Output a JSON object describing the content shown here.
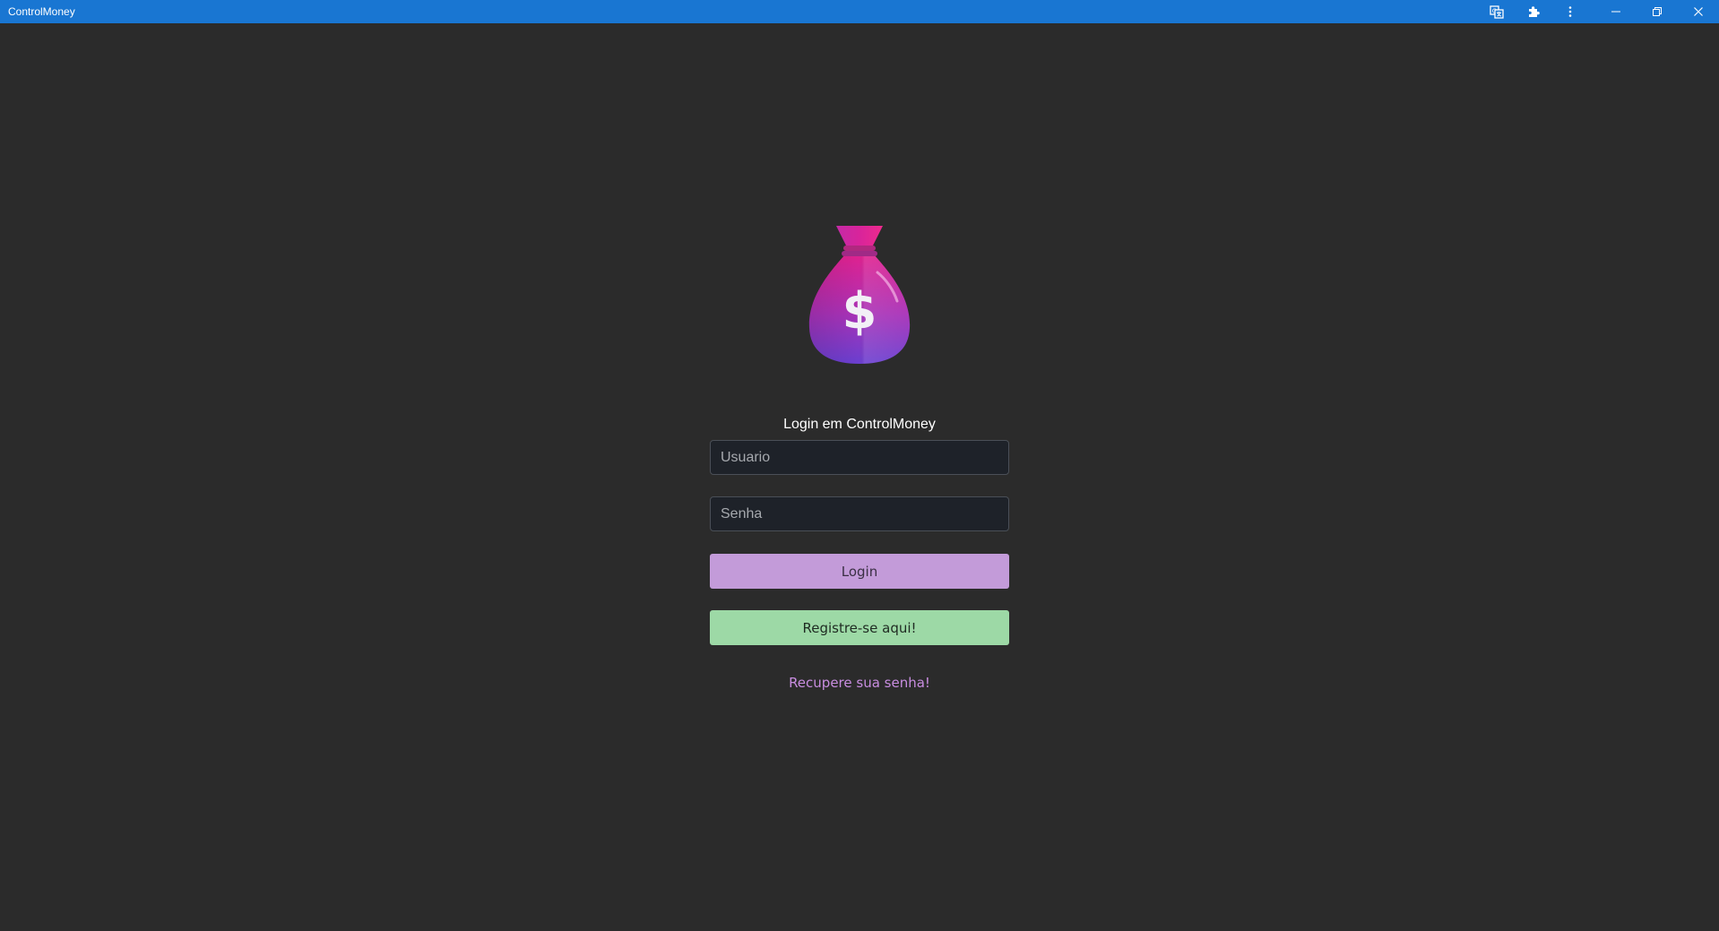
{
  "window": {
    "title": "ControlMoney",
    "toolbar_icons": [
      "translate-icon",
      "extensions-icon",
      "more-options-icon"
    ],
    "window_controls": [
      "minimize-icon",
      "restore-icon",
      "close-icon"
    ],
    "accent_color": "#1976d2"
  },
  "login": {
    "logo_icon": "money-bag-icon",
    "logo_symbol": "$",
    "heading": "Login em ControlMoney",
    "username": {
      "placeholder": "Usuario",
      "value": ""
    },
    "password": {
      "placeholder": "Senha",
      "value": ""
    },
    "login_button": "Login",
    "register_button": "Registre-se aqui!",
    "recover_link": "Recupere sua senha!",
    "colors": {
      "background": "#2b2b2b",
      "login_button": "#c39bd9",
      "register_button": "#9dd9a6",
      "link": "#c88de0"
    }
  }
}
